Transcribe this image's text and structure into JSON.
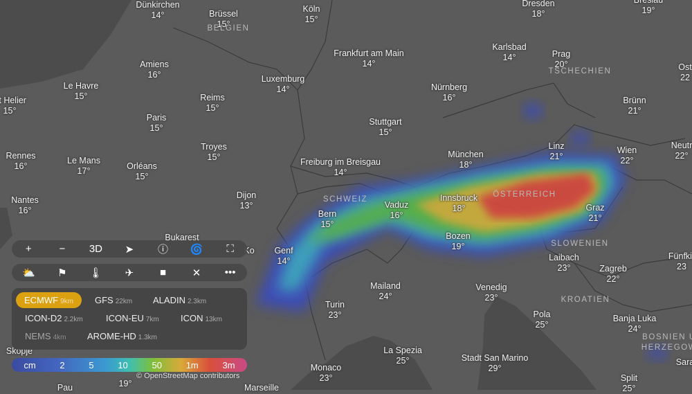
{
  "map": {
    "cities": [
      {
        "name": "Dünkirchen",
        "temp": "14°"
      },
      {
        "name": "Brüssel",
        "temp": "15°"
      },
      {
        "name": "Köln",
        "temp": "15°"
      },
      {
        "name": "Dresden",
        "temp": "18°"
      },
      {
        "name": "Breslau",
        "temp": "19°"
      },
      {
        "name": "Frankfurt am Main",
        "temp": "14°"
      },
      {
        "name": "Karlsbad",
        "temp": "14°"
      },
      {
        "name": "Prag",
        "temp": "20°"
      },
      {
        "name": "Ost",
        "temp": "22"
      },
      {
        "name": "Amiens",
        "temp": "16°"
      },
      {
        "name": "Le Havre",
        "temp": "15°"
      },
      {
        "name": "Luxemburg",
        "temp": "14°"
      },
      {
        "name": "Nürnberg",
        "temp": "16°"
      },
      {
        "name": "Reims",
        "temp": "15°"
      },
      {
        "name": "Brünn",
        "temp": "21°"
      },
      {
        "name": "St Helier",
        "temp": "15°"
      },
      {
        "name": "Paris",
        "temp": "15°"
      },
      {
        "name": "Stuttgart",
        "temp": "15°"
      },
      {
        "name": "Rennes",
        "temp": "16°"
      },
      {
        "name": "Troyes",
        "temp": "15°"
      },
      {
        "name": "Le Mans",
        "temp": "17°"
      },
      {
        "name": "Orléans",
        "temp": "15°"
      },
      {
        "name": "München",
        "temp": "18°"
      },
      {
        "name": "Linz",
        "temp": "21°"
      },
      {
        "name": "Wien",
        "temp": "22°"
      },
      {
        "name": "Neutr",
        "temp": "22°"
      },
      {
        "name": "Freiburg im Breisgau",
        "temp": "14°"
      },
      {
        "name": "Nantes",
        "temp": "16°"
      },
      {
        "name": "Dijon",
        "temp": "13°"
      },
      {
        "name": "Bern",
        "temp": "15°"
      },
      {
        "name": "Vaduz",
        "temp": "16°"
      },
      {
        "name": "Innsbruck",
        "temp": "18°"
      },
      {
        "name": "Graz",
        "temp": "21°"
      },
      {
        "name": "Bukarest",
        "temp": ""
      },
      {
        "name": "Bozen",
        "temp": "19°"
      },
      {
        "name": "Genf",
        "temp": "14°"
      },
      {
        "name": "Laibach",
        "temp": "23°"
      },
      {
        "name": "Zagreb",
        "temp": "22°"
      },
      {
        "name": "Fünfkir",
        "temp": "23"
      },
      {
        "name": "Mailand",
        "temp": "24°"
      },
      {
        "name": "Venedig",
        "temp": "23°"
      },
      {
        "name": "Turin",
        "temp": "23°"
      },
      {
        "name": "Pola",
        "temp": "25°"
      },
      {
        "name": "Banja Luka",
        "temp": "24°"
      },
      {
        "name": "Sara",
        "temp": ""
      },
      {
        "name": "Split",
        "temp": "25°"
      },
      {
        "name": "Skopje",
        "temp": ""
      },
      {
        "name": "La Spezia",
        "temp": "25°"
      },
      {
        "name": "Stadt San Marino",
        "temp": "29°"
      },
      {
        "name": "Monaco",
        "temp": "23°"
      },
      {
        "name": "",
        "temp": "19°"
      },
      {
        "name": "Pau",
        "temp": ""
      },
      {
        "name": "Marseille",
        "temp": ""
      },
      {
        "name": "Ko",
        "temp": ""
      }
    ],
    "countries": [
      "BELGIEN",
      "TSCHECHIEN",
      "SCHWEIZ",
      "ÖSTERREICH",
      "SLOWENIEN",
      "KROATIEN",
      "BOSNIEN U",
      "HERZEGOW"
    ]
  },
  "toolbar1": [
    {
      "icon": "plus-icon",
      "glyph": "+"
    },
    {
      "icon": "minus-icon",
      "glyph": "−"
    },
    {
      "icon": "3d-button",
      "glyph": "3D"
    },
    {
      "icon": "location-arrow-icon",
      "glyph": "➤"
    },
    {
      "icon": "info-icon",
      "glyph": "ⓘ"
    },
    {
      "icon": "hurricane-icon",
      "glyph": "🌀"
    },
    {
      "icon": "fullscreen-icon",
      "glyph": "⛶"
    }
  ],
  "toolbar2": [
    {
      "icon": "weather-cloud-sun-icon",
      "glyph": "⛅"
    },
    {
      "icon": "windsock-icon",
      "glyph": "⚑"
    },
    {
      "icon": "thermometer-icon",
      "glyph": "🌡"
    },
    {
      "icon": "airplane-icon",
      "glyph": "✈"
    },
    {
      "icon": "video-camera-icon",
      "glyph": "■"
    },
    {
      "icon": "close-icon",
      "glyph": "✕"
    },
    {
      "icon": "more-icon",
      "glyph": "•••"
    }
  ],
  "models": [
    {
      "name": "ECMWF",
      "res": "9km",
      "selected": true
    },
    {
      "name": "GFS",
      "res": "22km"
    },
    {
      "name": "ALADIN",
      "res": "2.3km"
    },
    {
      "name": "ICON-D2",
      "res": "2.2km"
    },
    {
      "name": "ICON-EU",
      "res": "7km"
    },
    {
      "name": "ICON",
      "res": "13km"
    },
    {
      "name": "NEMS",
      "res": "4km",
      "disabled": true
    },
    {
      "name": "AROME-HD",
      "res": "1.3km"
    }
  ],
  "legend": [
    "cm",
    "2",
    "5",
    "10",
    "50",
    "1m",
    "3m"
  ],
  "attribution": "© OpenStreetMap contributors",
  "colors": {
    "selected_model": "#dba111",
    "map_land": "#5b5b5b",
    "map_sea": "#4c4c4c"
  }
}
